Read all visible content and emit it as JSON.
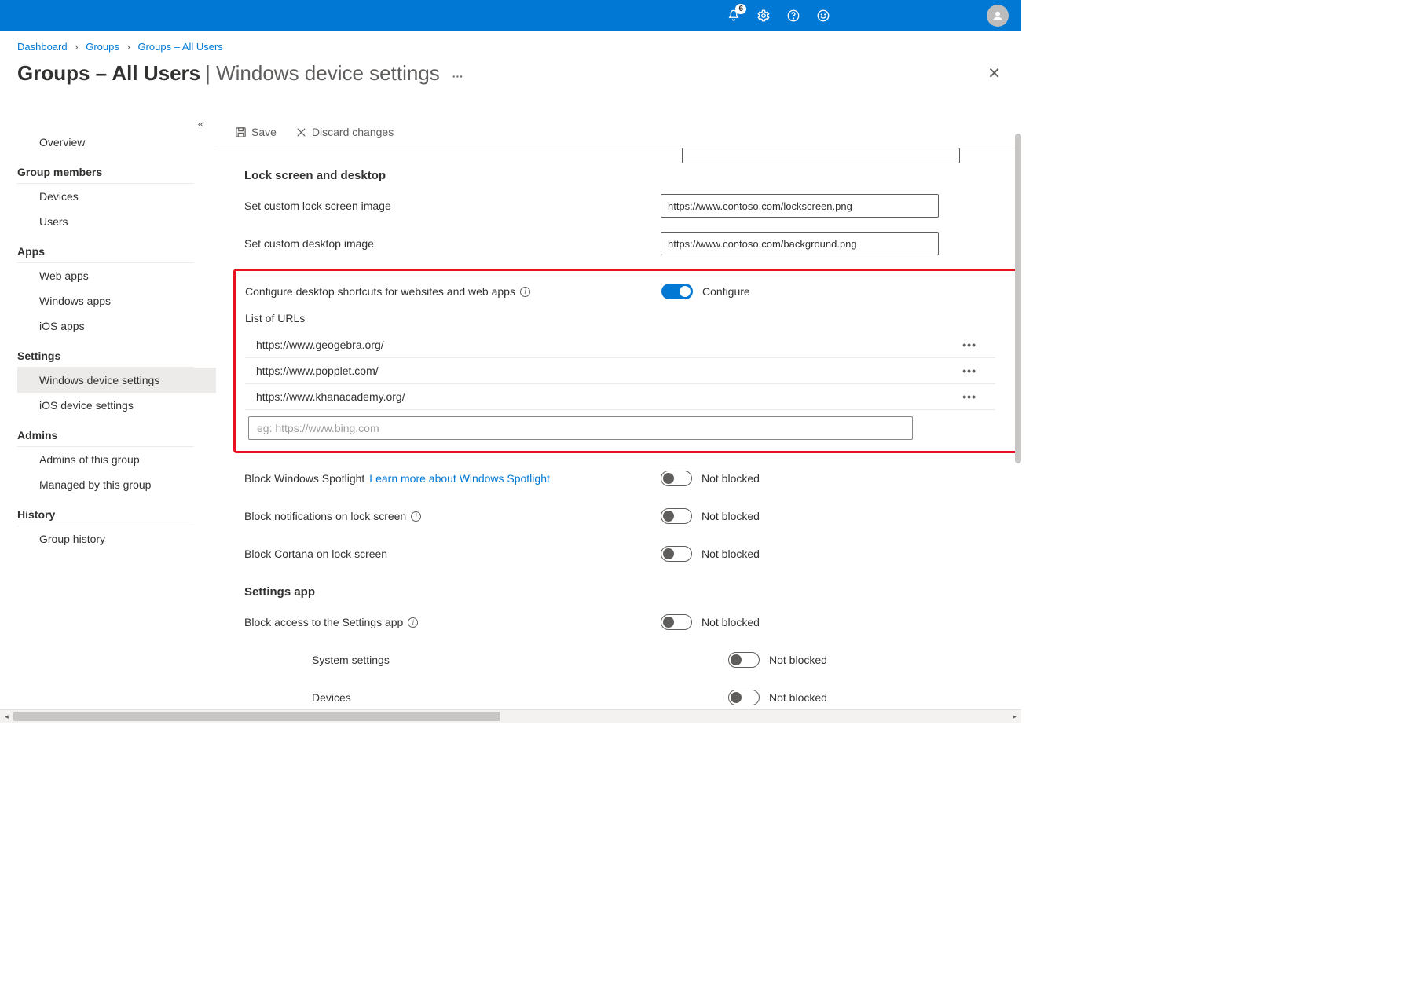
{
  "topbar": {
    "badge": "6"
  },
  "breadcrumb": {
    "dashboard": "Dashboard",
    "groups": "Groups",
    "all_users": "Groups – All Users"
  },
  "header": {
    "bold": "Groups – All Users",
    "sep": " | ",
    "thin": "Windows device settings"
  },
  "toolbar": {
    "save": "Save",
    "discard": "Discard changes"
  },
  "sidebar": {
    "overview": "Overview",
    "group_members": "Group members",
    "devices": "Devices",
    "users": "Users",
    "apps": "Apps",
    "web_apps": "Web apps",
    "windows_apps": "Windows apps",
    "ios_apps": "iOS apps",
    "settings": "Settings",
    "windows_device_settings": "Windows device settings",
    "ios_device_settings": "iOS device settings",
    "admins": "Admins",
    "admins_of_group": "Admins of this group",
    "managed_by_group": "Managed by this group",
    "history": "History",
    "group_history": "Group history"
  },
  "form": {
    "section_lock": "Lock screen and desktop",
    "lockscreen_label": "Set custom lock screen image",
    "lockscreen_value": "https://www.contoso.com/lockscreen.png",
    "desktop_label": "Set custom desktop image",
    "desktop_value": "https://www.contoso.com/background.png",
    "shortcuts_label": "Configure desktop shortcuts for websites and web apps",
    "shortcuts_toggle_label": "Configure",
    "list_of_urls": "List of URLs",
    "urls": [
      "https://www.geogebra.org/",
      "https://www.popplet.com/",
      "https://www.khanacademy.org/"
    ],
    "url_placeholder": "eg: https://www.bing.com",
    "spotlight_label": "Block Windows Spotlight",
    "spotlight_link": "Learn more about Windows Spotlight",
    "notifications_label": "Block notifications on lock screen",
    "cortana_label": "Block Cortana on lock screen",
    "not_blocked": "Not blocked",
    "section_settings": "Settings app",
    "block_settings_label": "Block access to the Settings app",
    "system_settings": "System settings",
    "devices": "Devices"
  }
}
